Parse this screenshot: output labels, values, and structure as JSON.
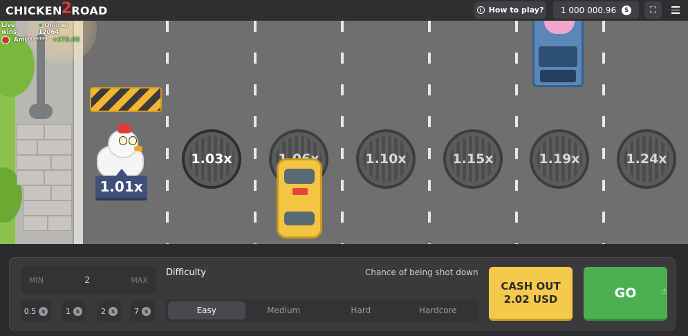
{
  "header": {
    "logo_left": "CHICKEN",
    "logo_mid": "2",
    "logo_right": "ROAD",
    "how_to_play": "How to play?",
    "balance": "1 000 000.96",
    "currency_symbol": "$"
  },
  "live": {
    "label": "Live wins",
    "online": "Online: 12064",
    "player": "Ami*******",
    "amount": "+€73.05"
  },
  "game": {
    "current_multiplier": "1.01x",
    "lanes": [
      {
        "multiplier": "1.03x"
      },
      {
        "multiplier": "1.06x"
      },
      {
        "multiplier": "1.10x"
      },
      {
        "multiplier": "1.15x"
      },
      {
        "multiplier": "1.19x"
      },
      {
        "multiplier": "1.24x"
      }
    ]
  },
  "controls": {
    "min_label": "MIN",
    "max_label": "MAX",
    "bet_value": "2",
    "quick_bets": [
      "0.5",
      "1",
      "2",
      "7"
    ],
    "difficulty_label": "Difficulty",
    "chance_label": "Chance of being shot down",
    "difficulties": [
      "Easy",
      "Medium",
      "Hard",
      "Hardcore"
    ],
    "selected_difficulty": "Easy",
    "cashout_line1": "CASH OUT",
    "cashout_line2": "2.02 USD",
    "go_label": "GO"
  }
}
